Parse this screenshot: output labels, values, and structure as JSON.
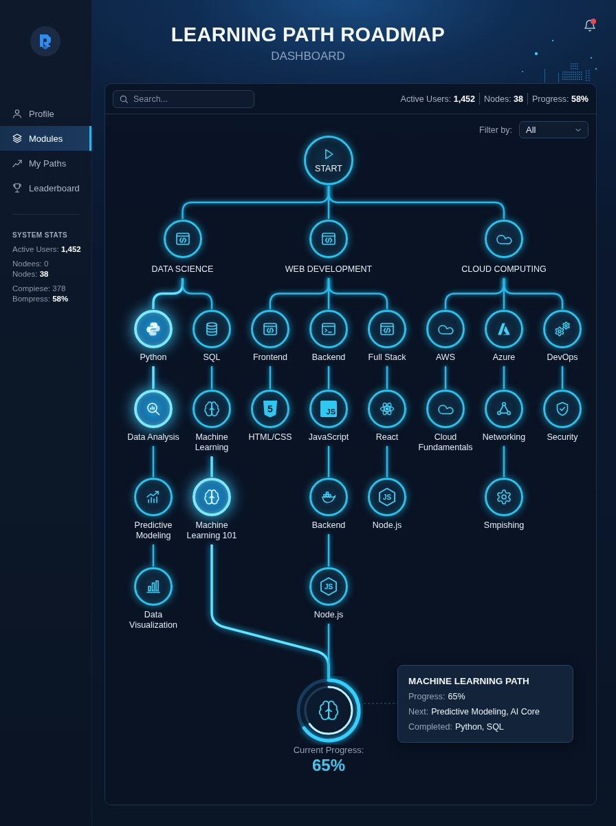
{
  "sidebar": {
    "nav": [
      {
        "label": "Profile",
        "selected": false
      },
      {
        "label": "Modules",
        "selected": true
      },
      {
        "label": "My Paths",
        "selected": false
      },
      {
        "label": "Leaderboard",
        "selected": false
      }
    ],
    "system_stats": {
      "title": "SYSTEM STATS",
      "groups": [
        [
          "Active Users: **1,452**"
        ],
        [
          "Nodees: 0",
          "Nodes: **38**"
        ],
        [
          "Compiese: 378",
          "Bompress: **58%**"
        ]
      ]
    }
  },
  "header": {
    "title": "LEARNING PATH ROADMAP",
    "subtitle": "DASHBOARD",
    "notifications": {
      "unread": true
    }
  },
  "toolbar": {
    "search": {
      "placeholder": "Search..."
    },
    "stats": [
      "Active Users: **1,452**",
      "Nodes: **38**",
      "Progress: **58%**"
    ],
    "filter": {
      "label": "Filter by:",
      "value": "All"
    }
  },
  "roadmap": {
    "root": {
      "label": "START",
      "highlighted": false,
      "children": [
        {
          "label": "DATA SCIENCE",
          "highlighted": false,
          "children": [
            {
              "label": "Python",
              "highlighted": true,
              "children": [
                {
                  "label": "Data Analysis",
                  "highlighted": true,
                  "children": [
                    {
                      "label": "Predictive Modeling",
                      "highlighted": false,
                      "children": [
                        {
                          "label": "Data Visualization",
                          "highlighted": false
                        }
                      ]
                    }
                  ]
                }
              ]
            },
            {
              "label": "SQL",
              "highlighted": false,
              "children": [
                {
                  "label": "Machine Learning",
                  "highlighted": false,
                  "children": [
                    {
                      "label": "Machine Learning 101",
                      "highlighted": true
                    }
                  ]
                }
              ]
            }
          ]
        },
        {
          "label": "WEB DEVELOPMENT",
          "highlighted": false,
          "children": [
            {
              "label": "Frontend",
              "highlighted": false,
              "children": [
                {
                  "label": "HTML/CSS",
                  "icon_text": "5",
                  "highlighted": false
                }
              ]
            },
            {
              "label": "Backend",
              "highlighted": false,
              "children": [
                {
                  "label": "JavaScript",
                  "icon_text": "JS",
                  "highlighted": false,
                  "children": [
                    {
                      "label": "Backend",
                      "highlighted": false,
                      "children": [
                        {
                          "label": "Node.js",
                          "icon_text": "JS",
                          "highlighted": false
                        }
                      ]
                    }
                  ]
                }
              ]
            },
            {
              "label": "Full Stack",
              "highlighted": false,
              "children": [
                {
                  "label": "React",
                  "highlighted": false,
                  "children": [
                    {
                      "label": "Node.js",
                      "icon_text": "JS",
                      "highlighted": false
                    }
                  ]
                }
              ]
            }
          ]
        },
        {
          "label": "CLOUD COMPUTING",
          "highlighted": false,
          "children": [
            {
              "label": "AWS",
              "highlighted": false,
              "children": [
                {
                  "label": "Cloud Fundamentals",
                  "highlighted": false
                }
              ]
            },
            {
              "label": "Azure",
              "highlighted": false,
              "children": [
                {
                  "label": "Networking",
                  "highlighted": false,
                  "children": [
                    {
                      "label": "Smpishing",
                      "highlighted": false
                    }
                  ]
                }
              ]
            },
            {
              "label": "DevOps",
              "highlighted": false,
              "children": [
                {
                  "label": "Security",
                  "highlighted": false
                }
              ]
            }
          ]
        }
      ]
    },
    "progress": {
      "label": "Current Progress:",
      "value": "65%",
      "level": 0.65
    },
    "details": {
      "title": "MACHINE LEARNING PATH",
      "rows": [
        {
          "label": "Progress:",
          "value": "65%"
        },
        {
          "label": "Next:",
          "value": "Predictive Modeling, AI Core"
        },
        {
          "label": "Completed:",
          "value": "Python, SQL"
        }
      ]
    }
  }
}
